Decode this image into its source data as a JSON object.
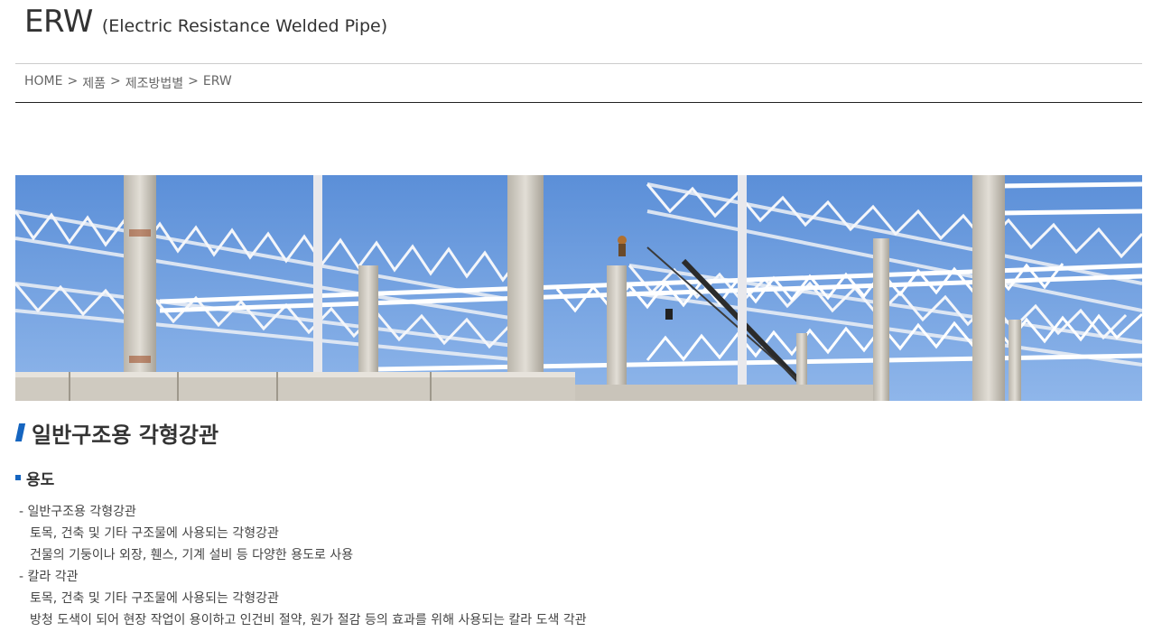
{
  "header": {
    "title": "ERW",
    "subtitle": "(Electric Resistance Welded Pipe)"
  },
  "breadcrumb": {
    "items": [
      "HOME",
      "제품",
      "제조방법별",
      "ERW"
    ],
    "separator": ">"
  },
  "hero": {
    "icon": "construction-truss-photo",
    "sky_color": "#6f9fe0",
    "truss_color": "#f2f4f8"
  },
  "section": {
    "title": "일반구조용 각형강관",
    "accent_color": "#1565c0"
  },
  "usage": {
    "title": "용도",
    "items": [
      {
        "head": "- 일반구조용 각형강관",
        "lines": [
          "토목, 건축 및 기타 구조물에 사용되는 각형강관",
          "건물의 기둥이나 외장, 휀스, 기계 설비 등 다양한 용도로 사용"
        ]
      },
      {
        "head": "- 칼라 각관",
        "lines": [
          "토목, 건축 및 기타 구조물에 사용되는 각형강관",
          "방청 도색이 되어 현장 작업이 용이하고 인건비 절약, 원가 절감 등의 효과를 위해 사용되는 칼라 도색 각관"
        ]
      }
    ]
  }
}
